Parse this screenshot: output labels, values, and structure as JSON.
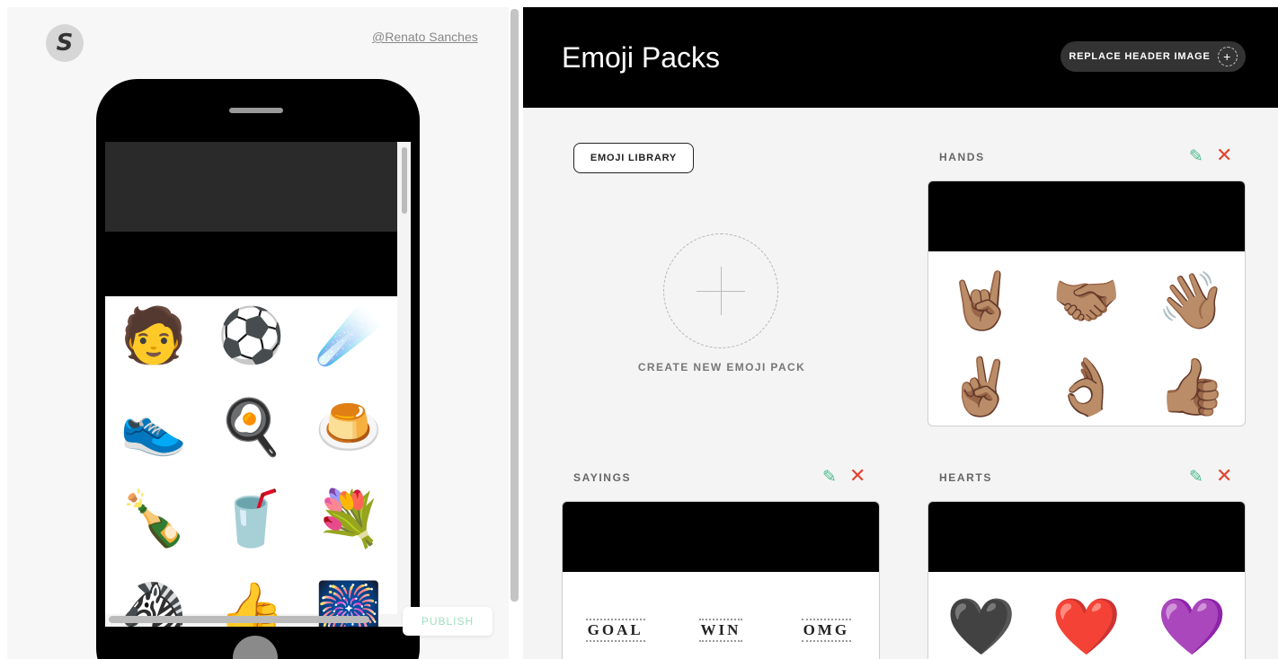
{
  "preview": {
    "logo_letter": "S",
    "username": "@Renato Sanches",
    "stickers": [
      "🧑",
      "⚽",
      "☄️",
      "👟",
      "🍳",
      "🍮",
      "🍾",
      "🥤",
      "💐",
      "🦓",
      "👍",
      "🎆"
    ],
    "publish_label": "PUBLISH"
  },
  "editor": {
    "title": "Emoji Packs",
    "replace_header_label": "REPLACE HEADER IMAGE",
    "replace_plus": "+",
    "library_label": "EMOJI LIBRARY",
    "create_label": "CREATE NEW EMOJI PACK",
    "edit_glyph": "✎",
    "delete_glyph": "✕",
    "packs": {
      "hands": {
        "title": "HANDS",
        "emojis": [
          "🤘🏽",
          "🤝🏽",
          "👋🏽",
          "✌🏽",
          "👌🏽",
          "👍🏽"
        ]
      },
      "sayings": {
        "title": "SAYINGS",
        "words": [
          "GOAL",
          "WIN",
          "OMG"
        ]
      },
      "hearts": {
        "title": "HEARTS",
        "emojis": [
          "🖤",
          "❤️",
          "💜"
        ]
      }
    }
  },
  "colors": {
    "accent_green": "#4cbb8e",
    "delete_red": "#e0442f",
    "publish_text": "#9fe0bf"
  }
}
